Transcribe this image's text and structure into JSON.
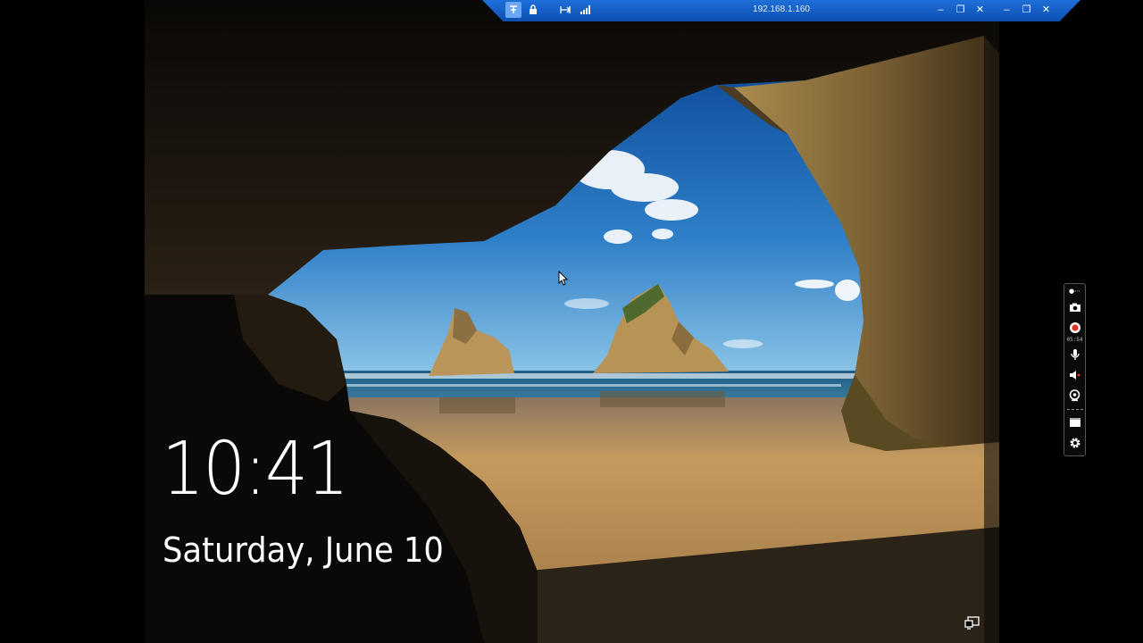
{
  "lockscreen": {
    "time": "10:41",
    "date": "Saturday, June 10"
  },
  "rdp_bar": {
    "connection_title": "192.168.1.160",
    "pin_icon": "pin-icon",
    "lock_icon": "lock-icon",
    "fit_icon": "fit-screen-icon",
    "signal_icon": "signal-bars-icon"
  },
  "side_toolbar": {
    "recording_time": "05:54",
    "icons": [
      "screenshot-camera-icon",
      "record-icon",
      "microphone-icon",
      "speaker-icon",
      "webcam-icon",
      "window-icon",
      "settings-gear-icon"
    ]
  },
  "colors": {
    "rdp_bar_blue": "#1e6fd9",
    "sky": "#2f7fc8",
    "sand": "#b48a52",
    "rock": "#5a4522"
  }
}
